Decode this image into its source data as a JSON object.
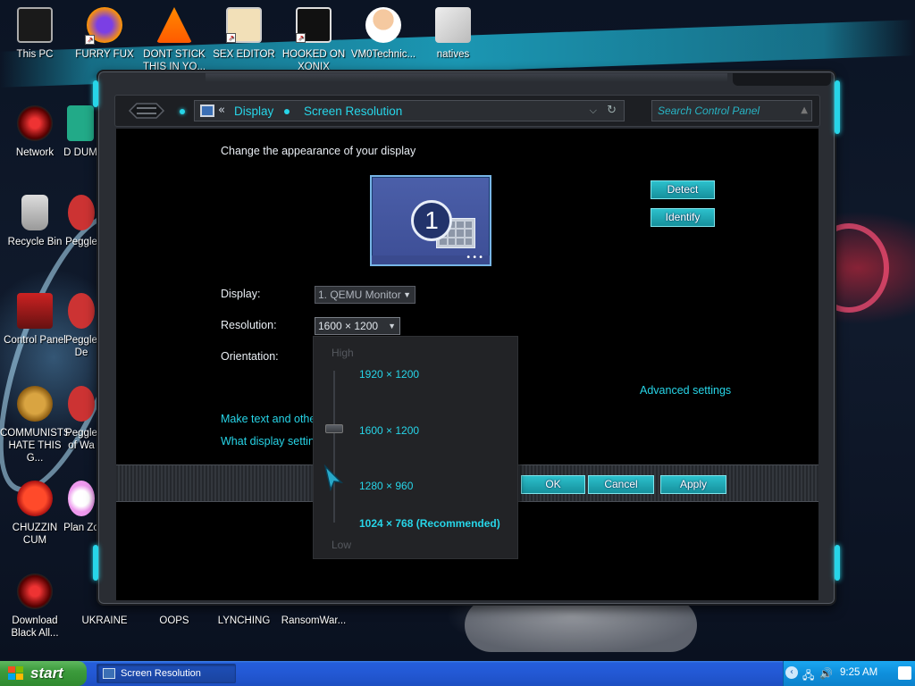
{
  "desktop": {
    "icons": [
      {
        "label": "This PC"
      },
      {
        "label": "FURRY FUX"
      },
      {
        "label": "DONT STICK THIS IN YO..."
      },
      {
        "label": "SEX EDITOR"
      },
      {
        "label": "HOOKED ON XONIX"
      },
      {
        "label": "VM0Technic..."
      },
      {
        "label": "natives"
      },
      {
        "label": "Network"
      },
      {
        "label": "D DUM"
      },
      {
        "label": "Recycle Bin"
      },
      {
        "label": "Peggle"
      },
      {
        "label": "Control Panel"
      },
      {
        "label": "Peggle De"
      },
      {
        "label": "COMMUNISTS HATE THIS G..."
      },
      {
        "label": "Peggle of Wa"
      },
      {
        "label": "CHUZZIN CUM"
      },
      {
        "label": "Plan Zo"
      },
      {
        "label": "Download Black All..."
      },
      {
        "label": "UKRAINE"
      },
      {
        "label": "OOPS"
      },
      {
        "label": "LYNCHING"
      },
      {
        "label": "RansomWar..."
      }
    ]
  },
  "window": {
    "breadcrumb": [
      "Display",
      "Screen Resolution"
    ],
    "breadcrumb_prefix": "«",
    "search_placeholder": "Search Control Panel",
    "heading": "Change the appearance of your display",
    "monitor_number": "1",
    "detect_label": "Detect",
    "identify_label": "Identify",
    "display_label": "Display:",
    "display_value": "1. QEMU Monitor",
    "resolution_label": "Resolution:",
    "resolution_value": "1600 × 1200",
    "orientation_label": "Orientation:",
    "advanced_link": "Advanced settings",
    "link_text_size": "Make text and other",
    "link_display_settings": "What display setting",
    "ok_label": "OK",
    "cancel_label": "Cancel",
    "apply_label": "Apply"
  },
  "resolution_dropdown": {
    "high_label": "High",
    "low_label": "Low",
    "options": [
      "1920 × 1200",
      "1600 × 1200",
      "1280 × 960",
      "1024 × 768 (Recommended)"
    ],
    "selected": "1600 × 1200"
  },
  "taskbar": {
    "start_label": "start",
    "task_label": "Screen Resolution",
    "clock": "9:25 AM"
  },
  "colors": {
    "accent": "#27d5e8",
    "window_bg": "#2a2d33",
    "content_bg": "#000000",
    "taskbar": "#245edb",
    "start": "#3c9b3c"
  }
}
